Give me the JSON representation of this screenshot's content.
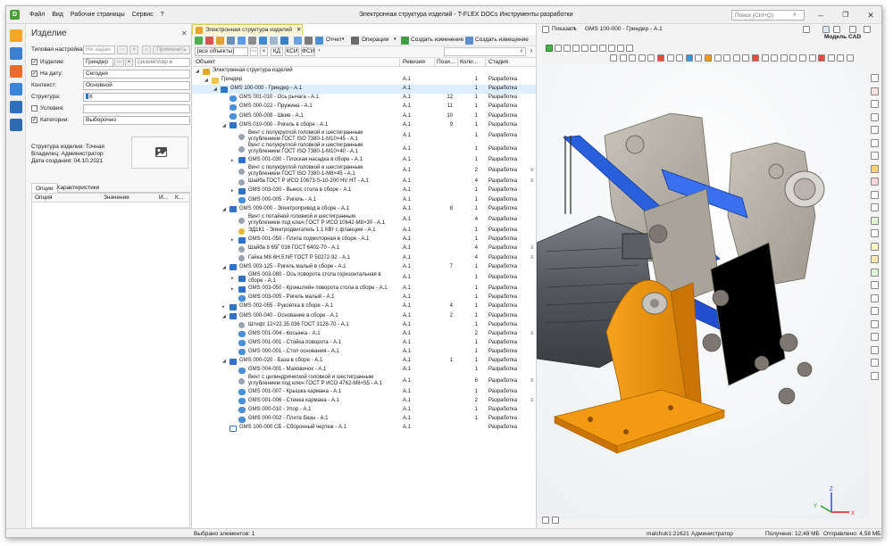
{
  "app": {
    "title": "Электронная структура изделий - T-FLEX DOCs Инструменты разработки",
    "logo": "D",
    "menu": [
      "Файл",
      "Вид",
      "Рабочие страницы",
      "Сервис",
      "?"
    ],
    "search_placeholder": "Поиск (Ctrl+Q)"
  },
  "panel": {
    "title": "Изделие",
    "typical_label": "Типовая настройка:",
    "typical_value": "Не задан",
    "apply_label": "Применить",
    "product_label": "Изделие:",
    "product_value": "Гриндер",
    "product_instance": "(экземпляр н",
    "date_label": "На дату:",
    "date_value": "Сегодня",
    "context_label": "Контекст:",
    "context_value": "Основной",
    "structure_label": "Структура:",
    "structure_value": "К",
    "conditions_label": "Условия:",
    "categories_label": "Категории:",
    "categories_value": "Выборочно",
    "info_structure": "Структура изделия: Точная",
    "info_owner": "Владелец: Администратор",
    "info_created": "Дата создания: 04.10.2021",
    "tab_options": "Опции",
    "tab_characteristics": "Характеристики",
    "col_option": "Опция",
    "col_value": "Значение",
    "col_i": "И...",
    "col_k": "К..."
  },
  "tree": {
    "tab_label": "Электронная структура изделий",
    "toolbar_report": "Отчет",
    "toolbar_operations": "Операции",
    "toolbar_create_change": "Создать изменение",
    "toolbar_create_notice": "Создать извещение",
    "filter_value": "[все объекты]",
    "filter_kd": "КД",
    "filter_ksi": "КСИ",
    "filter_fsi": "ФСИ",
    "headers": [
      "Объект",
      "Ревизия",
      "Пози...",
      "Коли...",
      "Стадия"
    ],
    "rows": [
      {
        "name": "Электронная структура изделий",
        "level": 0,
        "exp": "◢",
        "icon": "root",
        "rev": "",
        "pos": "",
        "qty": "",
        "stage": ""
      },
      {
        "name": "Гриндер",
        "level": 1,
        "exp": "◢",
        "icon": "folder",
        "rev": "A.1",
        "pos": "",
        "qty": "1",
        "stage": "Разработка"
      },
      {
        "name": "GMS 100-000 - Гриндер - A.1",
        "level": 2,
        "exp": "◢",
        "icon": "asm",
        "rev": "A.1",
        "pos": "",
        "qty": "1",
        "stage": "Разработка",
        "selected": true
      },
      {
        "name": "GMS 001-010 - Ось рычага - A.1",
        "level": 3,
        "exp": "",
        "icon": "part",
        "rev": "A.1",
        "pos": "12",
        "qty": "1",
        "stage": "Разработка"
      },
      {
        "name": "GMS 000-022 - Пружина - A.1",
        "level": 3,
        "exp": "",
        "icon": "part",
        "rev": "A.1",
        "pos": "11",
        "qty": "1",
        "stage": "Разработка"
      },
      {
        "name": "GMS 000-008 - Шкив - A.1",
        "level": 3,
        "exp": "",
        "icon": "part",
        "rev": "A.1",
        "pos": "10",
        "qty": "1",
        "stage": "Разработка"
      },
      {
        "name": "GMS 010-000 - Ригель в сборе - A.1",
        "level": 3,
        "exp": "◢",
        "icon": "asm",
        "rev": "A.1",
        "pos": "9",
        "qty": "1",
        "stage": "Разработка"
      },
      {
        "name": "Винт с полукруглой головкой и шестигранным|углублением ГОСТ ISO 7380-1-M10×45 - A.1",
        "level": 4,
        "exp": "",
        "icon": "std",
        "rev": "A.1",
        "pos": "",
        "qty": "1",
        "stage": "Разработка"
      },
      {
        "name": "Винт с полукруглой головкой и шестигранным|углублением ГОСТ ISO 7380-1-M10×40 - A.1",
        "level": 4,
        "exp": "",
        "icon": "std",
        "rev": "A.1",
        "pos": "",
        "qty": "1",
        "stage": "Разработка"
      },
      {
        "name": "GMS 001-030 - Плоская насадка в сборе - A.1",
        "level": 4,
        "exp": "▸",
        "icon": "asm",
        "rev": "A.1",
        "pos": "",
        "qty": "1",
        "stage": "Разработка"
      },
      {
        "name": "Винт с полукруглой головкой и шестигранным|углублением ГОСТ ISO 7380-1-M8×45 - A.1",
        "level": 4,
        "exp": "",
        "icon": "std",
        "rev": "A.1",
        "pos": "",
        "qty": "2",
        "stage": "Разработка",
        "attach": true
      },
      {
        "name": "Шайба ГОСТ Р ИСО 10673-S-10-200 HV HT - A.1",
        "level": 4,
        "exp": "",
        "icon": "std",
        "rev": "A.1",
        "pos": "",
        "qty": "4",
        "stage": "Разработка",
        "attach": true
      },
      {
        "name": "GMS 003-030 - Вынос стола в сборе - A.1",
        "level": 4,
        "exp": "▸",
        "icon": "asm",
        "rev": "A.1",
        "pos": "",
        "qty": "1",
        "stage": "Разработка"
      },
      {
        "name": "GMS 000-005 - Ригель - A.1",
        "level": 4,
        "exp": "",
        "icon": "part",
        "rev": "A.1",
        "pos": "",
        "qty": "1",
        "stage": "Разработка"
      },
      {
        "name": "GMS 009-000 - Электропривод в сборе - A.1",
        "level": 3,
        "exp": "◢",
        "icon": "asm",
        "rev": "A.1",
        "pos": "8",
        "qty": "1",
        "stage": "Разработка"
      },
      {
        "name": "Винт с потайной головкой и шестигранным|углублением под ключ ГОСТ Р ИСО 10642-M8×30 - A.1",
        "level": 4,
        "exp": "",
        "icon": "std",
        "rev": "A.1",
        "pos": "",
        "qty": "4",
        "stage": "Разработка"
      },
      {
        "name": "ЭД1К1 - Электродвигатель 1.1 КВт с фланцем - A.1",
        "level": 4,
        "exp": "",
        "icon": "buy",
        "rev": "A.1",
        "pos": "",
        "qty": "1",
        "stage": "Разработка"
      },
      {
        "name": "GMS 001-050 - Плита подмоторная в сборе - A.1",
        "level": 4,
        "exp": "▸",
        "icon": "asm",
        "rev": "A.1",
        "pos": "",
        "qty": "1",
        "stage": "Разработка"
      },
      {
        "name": "Шайба 8 65Г 016 ГОСТ 6402-70 - A.1",
        "level": 4,
        "exp": "",
        "icon": "std",
        "rev": "A.1",
        "pos": "",
        "qty": "4",
        "stage": "Разработка",
        "attach": true
      },
      {
        "name": "Гайка M8-6H.5.NF ГОСТ Р 50272-92 - A.1",
        "level": 4,
        "exp": "",
        "icon": "std",
        "rev": "A.1",
        "pos": "",
        "qty": "4",
        "stage": "Разработка",
        "attach": true
      },
      {
        "name": "GMS 003-125 - Ригель малый в сборе - A.1",
        "level": 3,
        "exp": "◢",
        "icon": "asm",
        "rev": "A.1",
        "pos": "7",
        "qty": "1",
        "stage": "Разработка"
      },
      {
        "name": "GMS 003-080 - Ось поворота стола горизонтальная в|сборе - A.1",
        "level": 4,
        "exp": "▸",
        "icon": "asm",
        "rev": "A.1",
        "pos": "",
        "qty": "1",
        "stage": "Разработка"
      },
      {
        "name": "GMS 003-050 - Кронштейн поворота стола в сборе - A.1",
        "level": 4,
        "exp": "▸",
        "icon": "asm",
        "rev": "A.1",
        "pos": "",
        "qty": "1",
        "stage": "Разработка"
      },
      {
        "name": "GMS 003-005 - Ригель малый - A.1",
        "level": 4,
        "exp": "",
        "icon": "part",
        "rev": "A.1",
        "pos": "",
        "qty": "1",
        "stage": "Разработка"
      },
      {
        "name": "GMS 002-055 - Рукоятка в сборе - A.1",
        "level": 3,
        "exp": "▸",
        "icon": "asm",
        "rev": "A.1",
        "pos": "4",
        "qty": "1",
        "stage": "Разработка"
      },
      {
        "name": "GMS 000-040 - Основание в сборе - A.1",
        "level": 3,
        "exp": "◢",
        "icon": "asm",
        "rev": "A.1",
        "pos": "2",
        "qty": "1",
        "stage": "Разработка"
      },
      {
        "name": "Штифт 12×22.35.036 ГОСТ 3128-70 - A.1",
        "level": 4,
        "exp": "",
        "icon": "std",
        "rev": "A.1",
        "pos": "",
        "qty": "1",
        "stage": "Разработка"
      },
      {
        "name": "GMS 001-004 - Косынка - A.1",
        "level": 4,
        "exp": "",
        "icon": "part",
        "rev": "A.1",
        "pos": "",
        "qty": "2",
        "stage": "Разработка",
        "attach": true
      },
      {
        "name": "GMS 001-001 - Стойка поворота - A.1",
        "level": 4,
        "exp": "",
        "icon": "part",
        "rev": "A.1",
        "pos": "",
        "qty": "1",
        "stage": "Разработка"
      },
      {
        "name": "GMS 000-001 - Стол основания - A.1",
        "level": 4,
        "exp": "",
        "icon": "part",
        "rev": "A.1",
        "pos": "",
        "qty": "1",
        "stage": "Разработка"
      },
      {
        "name": "GMS 000-020 - База в сборе - A.1",
        "level": 3,
        "exp": "◢",
        "icon": "asm",
        "rev": "A.1",
        "pos": "1",
        "qty": "1",
        "stage": "Разработка"
      },
      {
        "name": "GMS 004-001 - Маховичок - A.1",
        "level": 4,
        "exp": "",
        "icon": "part",
        "rev": "A.1",
        "pos": "",
        "qty": "1",
        "stage": "Разработка"
      },
      {
        "name": "Винт с цилиндрической головкой и шестигранным|углублением под ключ ГОСТ Р ИСО 4762-M8×55 - A.1",
        "level": 4,
        "exp": "",
        "icon": "std",
        "rev": "A.1",
        "pos": "",
        "qty": "6",
        "stage": "Разработка",
        "attach": true
      },
      {
        "name": "GMS 001-007 - Крышка кармана - A.1",
        "level": 4,
        "exp": "",
        "icon": "part",
        "rev": "A.1",
        "pos": "",
        "qty": "1",
        "stage": "Разработка"
      },
      {
        "name": "GMS 001-006 - Стенка кармана - A.1",
        "level": 4,
        "exp": "",
        "icon": "part",
        "rev": "A.1",
        "pos": "",
        "qty": "2",
        "stage": "Разработка",
        "attach": true
      },
      {
        "name": "GMS 000-010 - Упор - A.1",
        "level": 4,
        "exp": "",
        "icon": "part",
        "rev": "A.1",
        "pos": "",
        "qty": "1",
        "stage": "Разработка"
      },
      {
        "name": "GMS 000-002 - Плита базы - A.1",
        "level": 4,
        "exp": "",
        "icon": "part",
        "rev": "A.1",
        "pos": "",
        "qty": "1",
        "stage": "Разработка"
      },
      {
        "name": "GMS 100-000 СБ - Сборочный чертеж - A.1",
        "level": 3,
        "exp": "",
        "icon": "doc",
        "rev": "A.1",
        "pos": "",
        "qty": "",
        "stage": "Разработка"
      }
    ]
  },
  "viewer": {
    "show_label": "Показать",
    "object_label": "GMS 100-000 - Гриндер - A.1",
    "model_label": "Модель CAD",
    "axis_x": "X",
    "axis_y": "Y",
    "axis_z": "Z"
  },
  "status": {
    "selected": "Выбрано элементов: 1",
    "host": "malchuk1:21621",
    "user": "Администратор",
    "received": "Получено: 12,48 МБ",
    "sent": "Отправлено: 4,58 МБ"
  },
  "colors": {
    "accent": "#2e73c8",
    "tab_highlight": "#fff6d8",
    "selection": "#ddeefc",
    "model_orange": "#f39c12",
    "model_blue": "#2458d6"
  }
}
